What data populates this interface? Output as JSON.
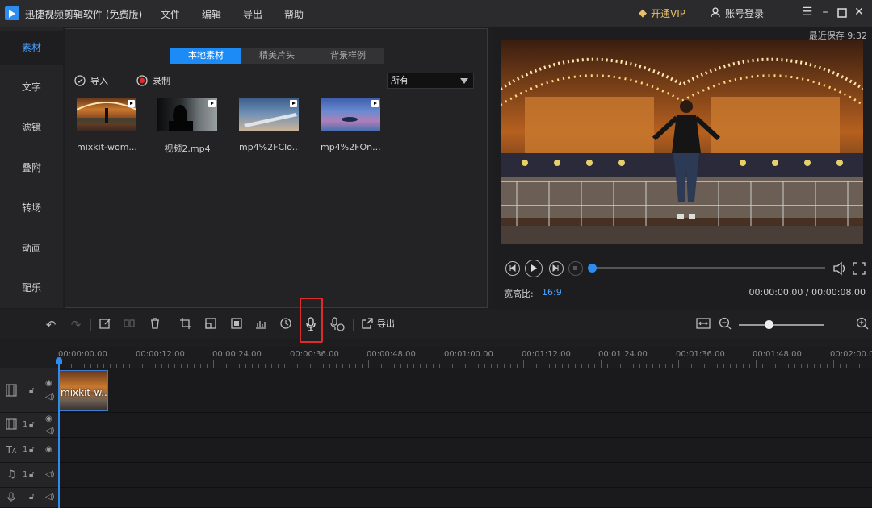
{
  "titlebar": {
    "app_title": "迅捷视频剪辑软件 (免费版)",
    "menus": [
      "文件",
      "编辑",
      "导出",
      "帮助"
    ],
    "vip": "开通VIP",
    "account": "账号登录"
  },
  "leftnav": {
    "items": [
      "素材",
      "文字",
      "滤镜",
      "叠附",
      "转场",
      "动画",
      "配乐"
    ],
    "active": "素材"
  },
  "media": {
    "tabs": [
      "本地素材",
      "精美片头",
      "背景样例"
    ],
    "active_tab": "本地素材",
    "import_label": "导入",
    "record_label": "录制",
    "filter_value": "所有",
    "items": [
      {
        "name": "mixkit-wom...",
        "thumb": "carnival"
      },
      {
        "name": "视频2.mp4",
        "thumb": "silhouette"
      },
      {
        "name": "mp4%2FClo...",
        "thumb": "wing"
      },
      {
        "name": "mp4%2FOn...",
        "thumb": "lake"
      }
    ]
  },
  "preview": {
    "last_saved": "最近保存 9:32",
    "aspect_label": "宽高比:",
    "aspect_value": "16:9",
    "timecode": "00:00:00.00 / 00:00:08.00",
    "progress": 0
  },
  "toolbar": {
    "export_label": "导出",
    "zoom_level": 0.35
  },
  "timeline": {
    "ticks": [
      "00:00:00.00",
      "00:00:12.00",
      "00:00:24.00",
      "00:00:36.00",
      "00:00:48.00",
      "00:01:00.00",
      "00:01:12.00",
      "00:01:24.00",
      "00:01:36.00",
      "00:01:48.00",
      "00:02:00.00"
    ],
    "track_number": "1",
    "clip_label": "mixkit-w..."
  },
  "colors": {
    "accent": "#2d8cf0",
    "highlight_box": "#e02b2b",
    "vip": "#e8c06a"
  }
}
